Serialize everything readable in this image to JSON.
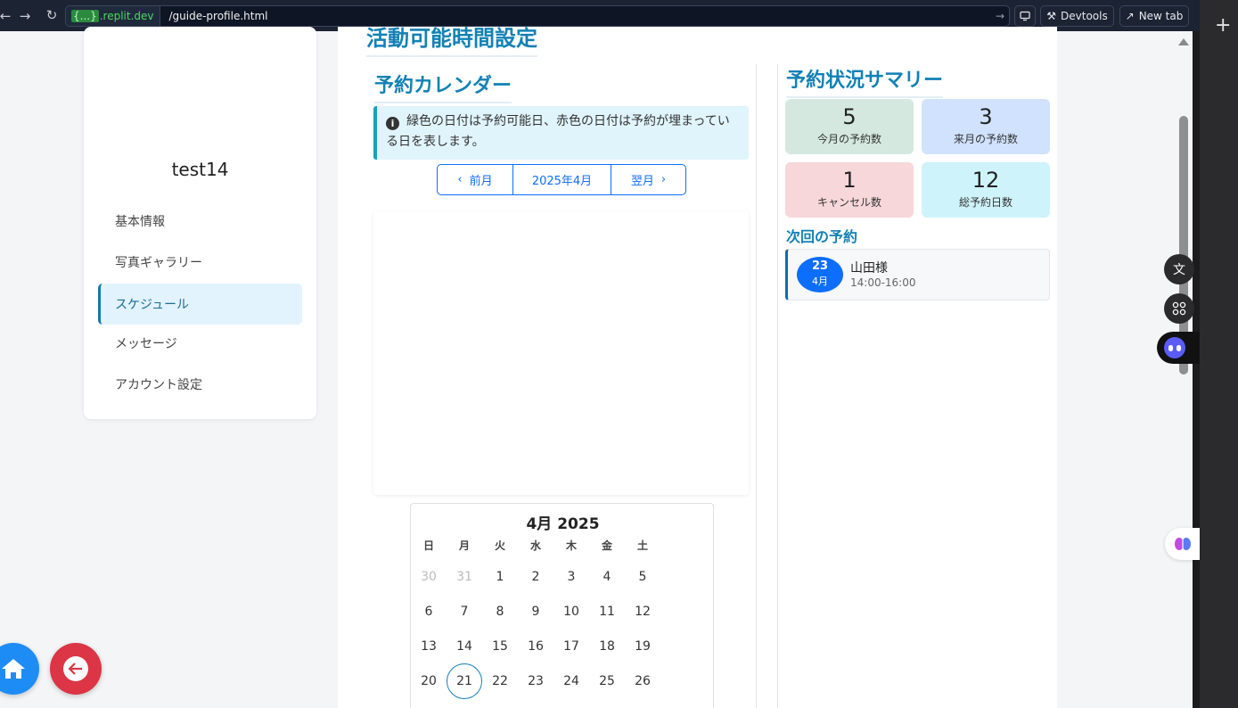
{
  "browser": {
    "host_brace": "{...}",
    "host": ".replit.dev",
    "path": "/guide-profile.html",
    "devtools": "Devtools",
    "new_tab": "New tab"
  },
  "sidebar": {
    "username": "test14",
    "items": [
      {
        "label": "基本情報",
        "active": false
      },
      {
        "label": "写真ギャラリー",
        "active": false
      },
      {
        "label": "スケジュール",
        "active": true
      },
      {
        "label": "メッセージ",
        "active": false
      },
      {
        "label": "アカウント設定",
        "active": false
      }
    ]
  },
  "main": {
    "title": "活動可能時間設定",
    "calendar_title": "予約カレンダー",
    "alert": "緑色の日付は予約可能日、赤色の日付は予約が埋まっている日を表します。",
    "nav": {
      "prev": "前月",
      "current": "2025年4月",
      "next": "翌月"
    },
    "mini_calendar": {
      "title": "4月 2025",
      "weekdays": [
        "日",
        "月",
        "火",
        "水",
        "木",
        "金",
        "土"
      ],
      "weeks": [
        [
          "30",
          "31",
          "1",
          "2",
          "3",
          "4",
          "5"
        ],
        [
          "6",
          "7",
          "8",
          "9",
          "10",
          "11",
          "12"
        ],
        [
          "13",
          "14",
          "15",
          "16",
          "17",
          "18",
          "19"
        ],
        [
          "20",
          "21",
          "22",
          "23",
          "24",
          "25",
          "26"
        ]
      ],
      "today": "21"
    }
  },
  "summary": {
    "title": "予約状況サマリー",
    "stats": [
      {
        "value": "5",
        "label": "今月の予約数",
        "color": "#d4e8df"
      },
      {
        "value": "3",
        "label": "来月の予約数",
        "color": "#d0e2fe"
      },
      {
        "value": "1",
        "label": "キャンセル数",
        "color": "#f7d7da"
      },
      {
        "value": "12",
        "label": "総予約日数",
        "color": "#cff3fa"
      }
    ],
    "next_title": "次回の予約",
    "next": {
      "day": "23",
      "month": "4月",
      "name": "山田様",
      "time": "14:00-16:00"
    }
  }
}
